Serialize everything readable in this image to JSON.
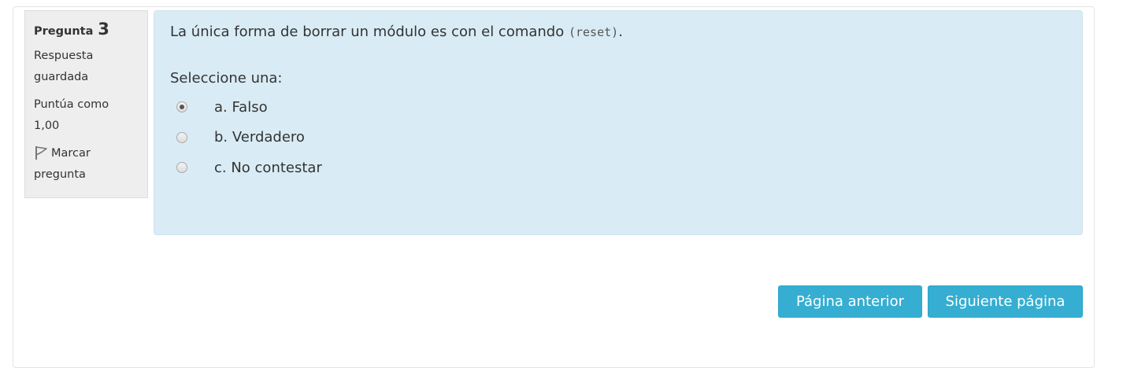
{
  "question_info": {
    "label": "Pregunta",
    "number": "3",
    "state_line1": "Respuesta",
    "state_line2": "guardada",
    "grade_line1": "Puntúa como",
    "grade_line2": "1,00",
    "flag_line1": "Marcar",
    "flag_line2": "pregunta",
    "flag_icon": "flag-icon"
  },
  "question": {
    "text_before": "La única forma de borrar un módulo es con el comando ",
    "code": "(reset)",
    "text_after": ".",
    "prompt": "Seleccione una:",
    "options": [
      {
        "label": "a. Falso",
        "selected": true
      },
      {
        "label": "b. Verdadero",
        "selected": false
      },
      {
        "label": "c. No contestar",
        "selected": false
      }
    ]
  },
  "navigation": {
    "prev_label": "Página anterior",
    "next_label": "Siguiente página"
  },
  "colors": {
    "content_background": "#d9ecf5",
    "info_background": "#eeeeee",
    "button_background": "#35aed1"
  }
}
